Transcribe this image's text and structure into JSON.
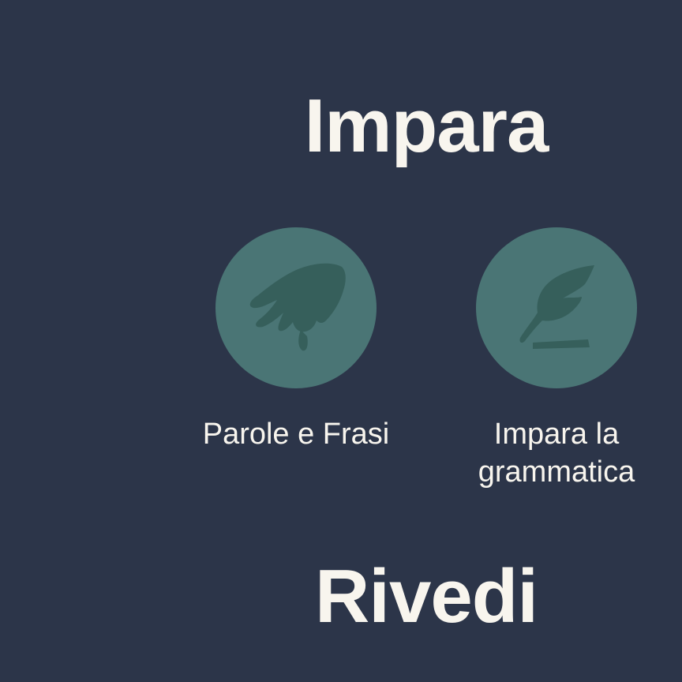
{
  "sections": {
    "learn": {
      "title": "Impara",
      "items": [
        {
          "label": "Parole e Frasi",
          "icon": "hand-pinch-icon"
        },
        {
          "label": "Impara la grammatica",
          "icon": "quill-pen-icon"
        }
      ]
    },
    "review": {
      "title": "Rivedi"
    }
  },
  "colors": {
    "background": "#2c3549",
    "circle": "#4a7575",
    "icon": "#365f5b",
    "text": "#f8f5ee"
  }
}
